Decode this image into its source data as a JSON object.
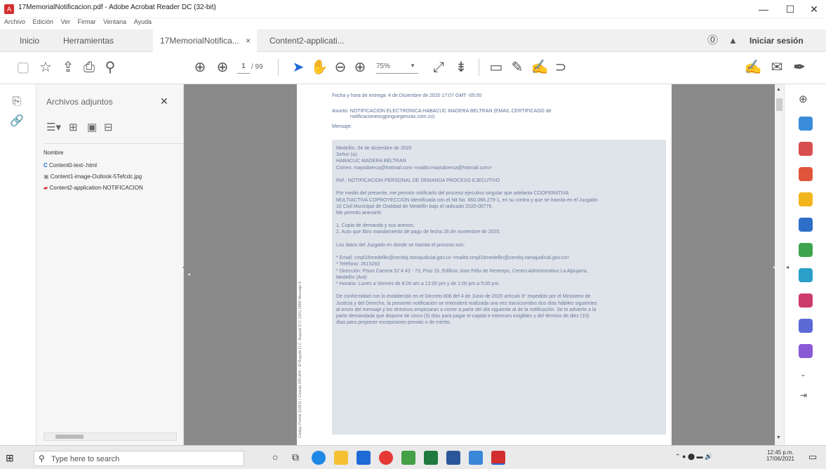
{
  "window": {
    "title": "17MemorialNotificacion.pdf - Adobe Acrobat Reader DC (32-bit)",
    "minimize": "—",
    "maximize": "☐",
    "close": "✕"
  },
  "menu": [
    "Archivo",
    "Edición",
    "Ver",
    "Firmar",
    "Ventana",
    "Ayuda"
  ],
  "tabs": {
    "inicio": "Inicio",
    "herramientas": "Herramientas",
    "doc_tab": "17MemorialNotifica...",
    "doc_tab_close": "×",
    "doc_tab2": "Content2-applicati...",
    "signin": "Iniciar sesión"
  },
  "toolbar": {
    "page_current": "1",
    "page_total": "/ 99",
    "zoom": "75%"
  },
  "attachments": {
    "title": "Archivos adjuntos",
    "close": "✕",
    "column_header": "Nombre",
    "items": [
      "Content0-text-.html",
      "Content1-image-Outlook-5Tefcdc.jpg",
      "Content2-application-NOTIFICACION"
    ]
  },
  "document": {
    "side_stamp": "Código Postal 110911 | Cédula 205.604 - El Bogotá D.C. Bogotá D.C (181) 2880 Mensaje 8",
    "header_line1": "Fecha y hora de entrega: 4 de Diciembre de 2020 17:07 GMT -05:00",
    "header_line2a": "Asunto: NOTIFICACION ELECTRONICA HABACUC MADERA BELTRAN (EMAIL CERTIFICADO de",
    "header_line2b": "notificacionescgpinguegenzas.com.co)",
    "header_line3": "Mensaje:",
    "body_lines": [
      "Medellín, 04 de diciembre de 2020",
      "Señor (a):",
      "HABACUC MADERA BELTRAN",
      "Correo: maysdoerca@hotmail.com <mailto:maysdoerca@hotmail.com>",
      "",
      "Ref.: NOTIFICACION PERSONAL DE DEMANDA PROCESO EJECUTIVO",
      "",
      "Por medio del presente, me permito notificarlo del proceso ejecutivo singular que adelanta COOPERATIVA",
      "MULTIACTIVA COPROYECCION identificada con el Nit No. 860.066.279-1, en su contra y que se tramita en el Juzgado",
      "16 Civil Municipal de Oralidad de Medellín bajo el radicado 2020-00776.",
      "Me permito anexarle:",
      "",
      "1.  Copia de demanda y sus anexos.",
      "2.  Auto que libro mandamiento de pago de fecha 26 de noviembre de 2020.",
      "",
      "Los datos del Juzgado en donde se tramita el proceso son:",
      "",
      "*  Email: cmpl16medellin@cendoj.ramajudicial.gov.co <mailto:cmpl16medellin@cendoj.ramajudicial.gov.co>",
      "*  Teléfono: 2615283",
      "*  Dirección: Pisos Carrera 52 # 42 - 73, Piso 15, Edificio Jose Félix de Restrepo, Centro Administrativo La Alpujarra,",
      "Medellín (Ant)",
      "*  Horario: Lunes a Viernes de 8:00 am a 12:00 pm y de 1:00 pm a 5:00 pm.",
      "",
      "De conformidad con lo establecido en el Decreto 806 del 4 de Junio de 2020 artículo 8° expedido por el Ministerio de",
      "Justicia y del Derecho, la presente notificación se entenderá realizada una vez transcurridos dos días hábiles siguientes",
      "al envío del mensaje y los términos empezaran a correr a partir del día siguiente al de la notificación. Se le advierte a la",
      "parte demandada que dispone de cinco (5) días para pagar el capital e intereses exigibles y del término de diez (10)",
      "días para proponer excepciones previas o de mérito."
    ]
  },
  "taskbar": {
    "search_placeholder": "Type here to search",
    "time": "12:45 p.m.",
    "date": "17/06/2021"
  }
}
